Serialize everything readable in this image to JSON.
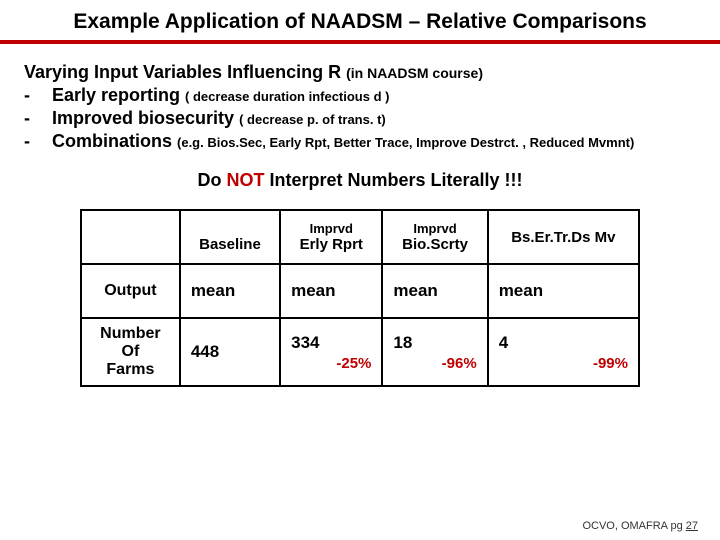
{
  "title": "Example Application of  NAADSM  – Relative Comparisons",
  "section": {
    "heading_main": "Varying Input Variables Influencing  R",
    "heading_sub": "(in NAADSM course)",
    "b1_label": "Early reporting",
    "b1_sub": "( decrease duration infectious  d )",
    "b2_label": "Improved biosecurity",
    "b2_sub": "( decrease  p. of trans.   t)",
    "b3_label": "Combinations",
    "b3_sub": "(e.g. Bios.Sec, Early Rpt, Better Trace, Improve Destrct. , Reduced Mvmnt)"
  },
  "instruction_pre": "Do",
  "instruction_not": "NOT",
  "instruction_post": "Interpret  Numbers Literally  !!!",
  "table": {
    "col1_header": "Baseline",
    "col2_top": "Imprvd",
    "col2_bot": "Erly Rprt",
    "col3_top": "Imprvd",
    "col3_bot": "Bio.Scrty",
    "col4_top": "Bs.Er.Tr.Ds",
    "col4_bot": "Mv",
    "row1_label": "Output",
    "row1_v1": "mean",
    "row1_v2": "mean",
    "row1_v3": "mean",
    "row1_v4": "mean",
    "row2_label_l1": "Number",
    "row2_label_l2": "Of",
    "row2_label_l3": "Farms",
    "row2_v1": "448",
    "row2_v2": "334",
    "row2_v2_pct": "-25%",
    "row2_v3": "18",
    "row2_v3_pct": "-96%",
    "row2_v4": "4",
    "row2_v4_pct": "-99%"
  },
  "footer_text": "OCVO, OMAFRA  pg",
  "footer_page": "27",
  "chart_data": {
    "type": "table",
    "title": "Relative comparison of Number Of Farms (mean) across scenarios",
    "categories": [
      "Baseline",
      "Imprvd Erly Rprt",
      "Imprvd Bio.Scrty",
      "Bs.Er.Tr.Ds Mv"
    ],
    "series": [
      {
        "name": "mean",
        "values": [
          448,
          334,
          18,
          4
        ]
      },
      {
        "name": "pct_change_vs_baseline",
        "values": [
          null,
          -25,
          -96,
          -99
        ]
      }
    ]
  }
}
